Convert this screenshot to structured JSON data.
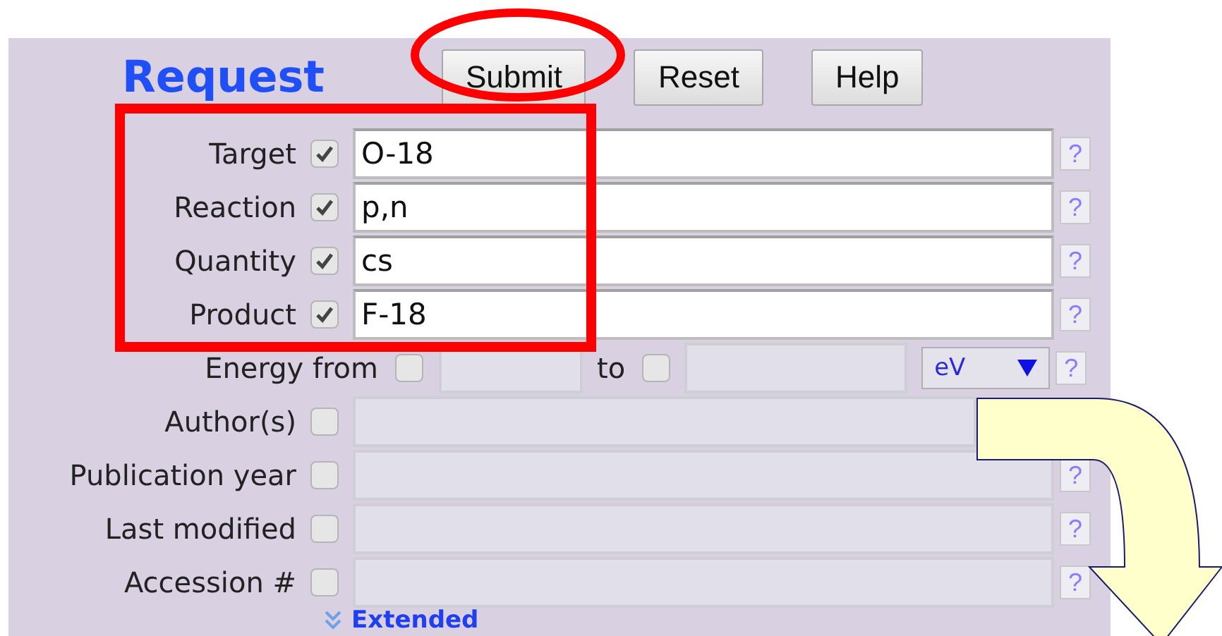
{
  "form": {
    "title": "Request",
    "buttons": [
      "Submit",
      "Reset",
      "Help"
    ],
    "fields": [
      {
        "kind": "text",
        "label": "Target",
        "checked": true,
        "disabled": false,
        "value": "O-18",
        "help": "?"
      },
      {
        "kind": "text",
        "label": "Reaction",
        "checked": true,
        "disabled": false,
        "value": "p,n",
        "help": "?"
      },
      {
        "kind": "text",
        "label": "Quantity",
        "checked": true,
        "disabled": false,
        "value": "cs",
        "help": "?"
      },
      {
        "kind": "text",
        "label": "Product",
        "checked": true,
        "disabled": false,
        "value": "F-18",
        "help": "?"
      },
      {
        "kind": "range",
        "label": "Energy from",
        "checked": false,
        "disabled": true,
        "to_label": "to",
        "to_checked": false,
        "unit": "eV",
        "help": "?"
      },
      {
        "kind": "text",
        "label": "Author(s)",
        "checked": false,
        "disabled": true
      },
      {
        "kind": "text",
        "label": "Publication year",
        "checked": false,
        "disabled": true,
        "help": "?"
      },
      {
        "kind": "text",
        "label": "Last modified",
        "checked": false,
        "disabled": true,
        "help": "?"
      },
      {
        "kind": "text",
        "label": "Accession #",
        "checked": false,
        "disabled": true,
        "help": "?"
      }
    ],
    "extended_link": "Extended"
  },
  "annotations": [
    {
      "kind": "ellipse"
    },
    {
      "kind": "rectangle"
    },
    {
      "kind": "arrow"
    }
  ]
}
